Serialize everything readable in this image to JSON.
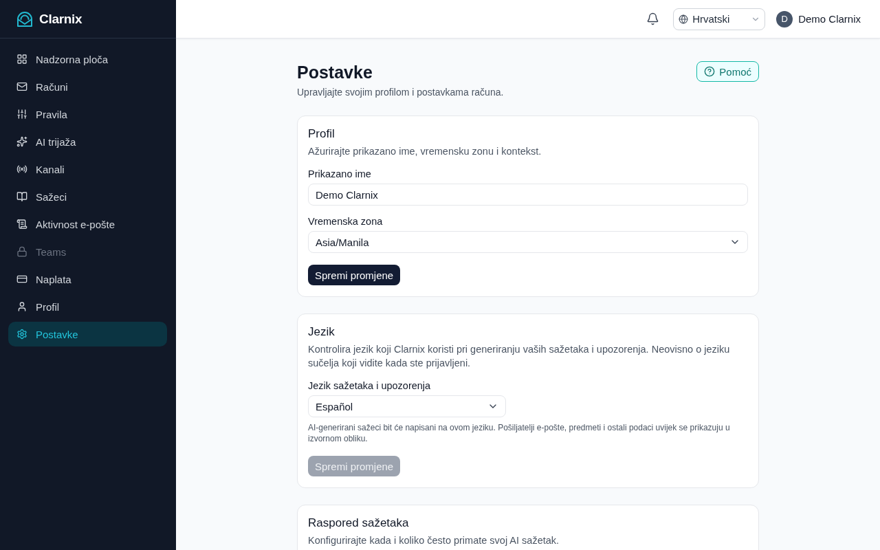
{
  "brand": {
    "name": "Clarnix"
  },
  "sidebar": {
    "items": [
      {
        "label": "Nadzorna ploča",
        "selected": false,
        "disabled": false
      },
      {
        "label": "Računi",
        "selected": false,
        "disabled": false
      },
      {
        "label": "Pravila",
        "selected": false,
        "disabled": false
      },
      {
        "label": "AI trijaža",
        "selected": false,
        "disabled": false
      },
      {
        "label": "Kanali",
        "selected": false,
        "disabled": false
      },
      {
        "label": "Sažeci",
        "selected": false,
        "disabled": false
      },
      {
        "label": "Aktivnost e-pošte",
        "selected": false,
        "disabled": false
      },
      {
        "label": "Teams",
        "selected": false,
        "disabled": true
      },
      {
        "label": "Naplata",
        "selected": false,
        "disabled": false
      },
      {
        "label": "Profil",
        "selected": false,
        "disabled": false
      },
      {
        "label": "Postavke",
        "selected": true,
        "disabled": false
      }
    ]
  },
  "header": {
    "language": {
      "value": "Hrvatski"
    },
    "user": {
      "initial": "D",
      "name": "Demo Clarnix"
    }
  },
  "page": {
    "title": "Postavke",
    "subtitle": "Upravljajte svojim profilom i postavkama računa.",
    "help_button": "Pomoć"
  },
  "cards": [
    {
      "title": "Profil",
      "description": "Ažurirajte prikazano ime, vremensku zonu i kontekst.",
      "fields": [
        {
          "kind": "input",
          "label": "Prikazano ime",
          "value": "Demo Clarnix"
        },
        {
          "kind": "select",
          "label": "Vremenska zona",
          "value": "Asia/Manila"
        }
      ],
      "button": {
        "label": "Spremi promjene",
        "disabled": false
      }
    },
    {
      "title": "Jezik",
      "description": "Kontrolira jezik koji Clarnix koristi pri generiranju vaših sažetaka i upozorenja. Neovisno o jeziku sučelja koji vidite kada ste prijavljeni.",
      "fields": [
        {
          "kind": "compactselect",
          "label": "Jezik sažetaka i upozorenja",
          "value": "Español",
          "hint": "AI-generirani sažeci bit će napisani na ovom jeziku. Pošiljatelji e-pošte, predmeti i ostali podaci uvijek se prikazuju u izvornom obliku."
        }
      ],
      "button": {
        "label": "Spremi promjene",
        "disabled": true
      }
    },
    {
      "title": "Raspored sažetaka",
      "description": "Konfigurirajte kada i koliko često primate svoj AI sažetak."
    }
  ]
}
